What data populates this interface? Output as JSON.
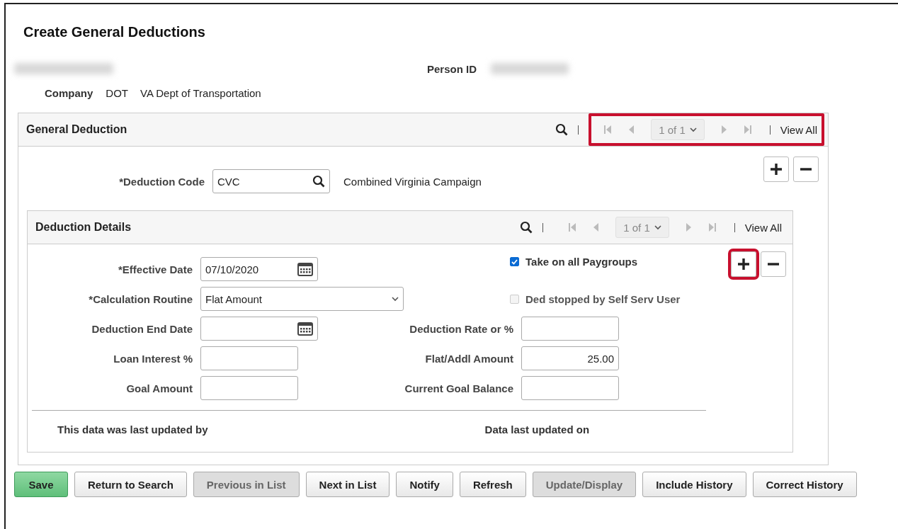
{
  "title": "Create General Deductions",
  "header": {
    "person_id_label": "Person ID",
    "company_label": "Company",
    "company_code": "DOT",
    "company_name": "VA Dept of Transportation"
  },
  "general_deduction": {
    "title": "General Deduction",
    "nav": {
      "counter": "1 of 1",
      "view_all": "View All",
      "highlighted": true
    },
    "add_highlighted": false,
    "code_label": "*Deduction Code",
    "code_value": "CVC",
    "code_description": "Combined Virginia Campaign",
    "details": {
      "title": "Deduction Details",
      "nav": {
        "counter": "1 of 1",
        "view_all": "View All",
        "highlighted": false
      },
      "add_highlighted": true,
      "left_fields": [
        {
          "kind": "date",
          "label": "*Effective Date",
          "value": "07/10/2020"
        },
        {
          "kind": "select",
          "label": "*Calculation Routine",
          "value": "Flat Amount"
        },
        {
          "kind": "date",
          "label": "Deduction End Date"
        },
        {
          "kind": "text",
          "label": "Loan Interest %"
        },
        {
          "kind": "text",
          "label": "Goal Amount"
        }
      ],
      "checkboxes": [
        {
          "label": "Take on all Paygroups",
          "checked": true,
          "disabled": false
        },
        {
          "label": "Ded stopped by Self Serv User",
          "checked": false,
          "disabled": true
        }
      ],
      "right_fields": [
        {
          "label": "Deduction Rate or %"
        },
        {
          "label": "Flat/Addl Amount",
          "value": "25.00"
        },
        {
          "label": "Current Goal Balance"
        }
      ],
      "updated_by_label": "This data was last updated by",
      "updated_on_label": "Data last updated on"
    }
  },
  "buttons": [
    {
      "label": "Save",
      "primary": true,
      "disabled": false
    },
    {
      "label": "Return to Search",
      "primary": false,
      "disabled": false
    },
    {
      "label": "Previous in List",
      "primary": false,
      "disabled": true
    },
    {
      "label": "Next in List",
      "primary": false,
      "disabled": false
    },
    {
      "label": "Notify",
      "primary": false,
      "disabled": false
    },
    {
      "label": "Refresh",
      "primary": false,
      "disabled": false
    },
    {
      "label": "Update/Display",
      "primary": false,
      "disabled": true
    },
    {
      "label": "Include History",
      "primary": false,
      "disabled": false
    },
    {
      "label": "Correct History",
      "primary": false,
      "disabled": false
    }
  ]
}
